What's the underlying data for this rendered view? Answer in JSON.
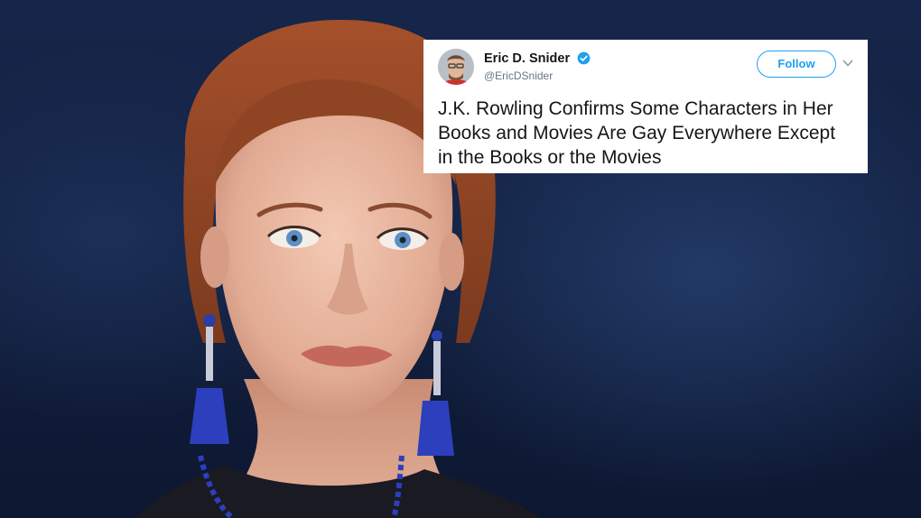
{
  "tweet": {
    "display_name": "Eric D. Snider",
    "handle": "@EricDSnider",
    "verified": true,
    "follow_label": "Follow",
    "text": "J.K. Rowling Confirms Some Characters in Her Books and Movies Are Gay Everywhere Except in the Books or the Movies"
  },
  "icons": {
    "verified": "verified-badge-icon",
    "caret": "chevron-down-icon"
  },
  "colors": {
    "brand_blue": "#1da1f2",
    "text_primary": "#14171a",
    "text_secondary": "#657786",
    "background": "#14244a"
  }
}
